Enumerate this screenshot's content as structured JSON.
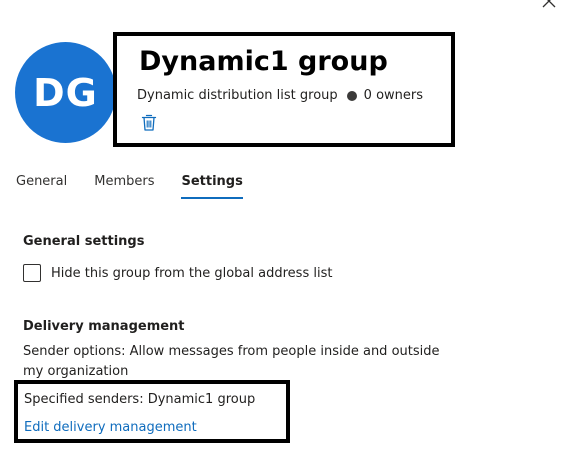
{
  "panel": {
    "close_icon": "close-icon",
    "avatar_initials": "DG",
    "avatar_color": "#1a73d1"
  },
  "header": {
    "title": "Dynamic1 group",
    "group_type": "Dynamic distribution list group",
    "owners": "0 owners",
    "delete_icon": "trash-icon"
  },
  "tabs": [
    {
      "label": "General",
      "active": false
    },
    {
      "label": "Members",
      "active": false
    },
    {
      "label": "Settings",
      "active": true
    }
  ],
  "general_settings": {
    "heading": "General settings",
    "hide_from_gal_label": "Hide this group from the global address list",
    "hide_from_gal_checked": false
  },
  "delivery_management": {
    "heading": "Delivery management",
    "sender_options": "Sender options: Allow messages from people inside and outside my organization",
    "specified_senders": "Specified senders: Dynamic1 group",
    "edit_link": "Edit delivery management"
  },
  "colors": {
    "accent": "#0f6cbd",
    "highlight_border": "#000000"
  }
}
